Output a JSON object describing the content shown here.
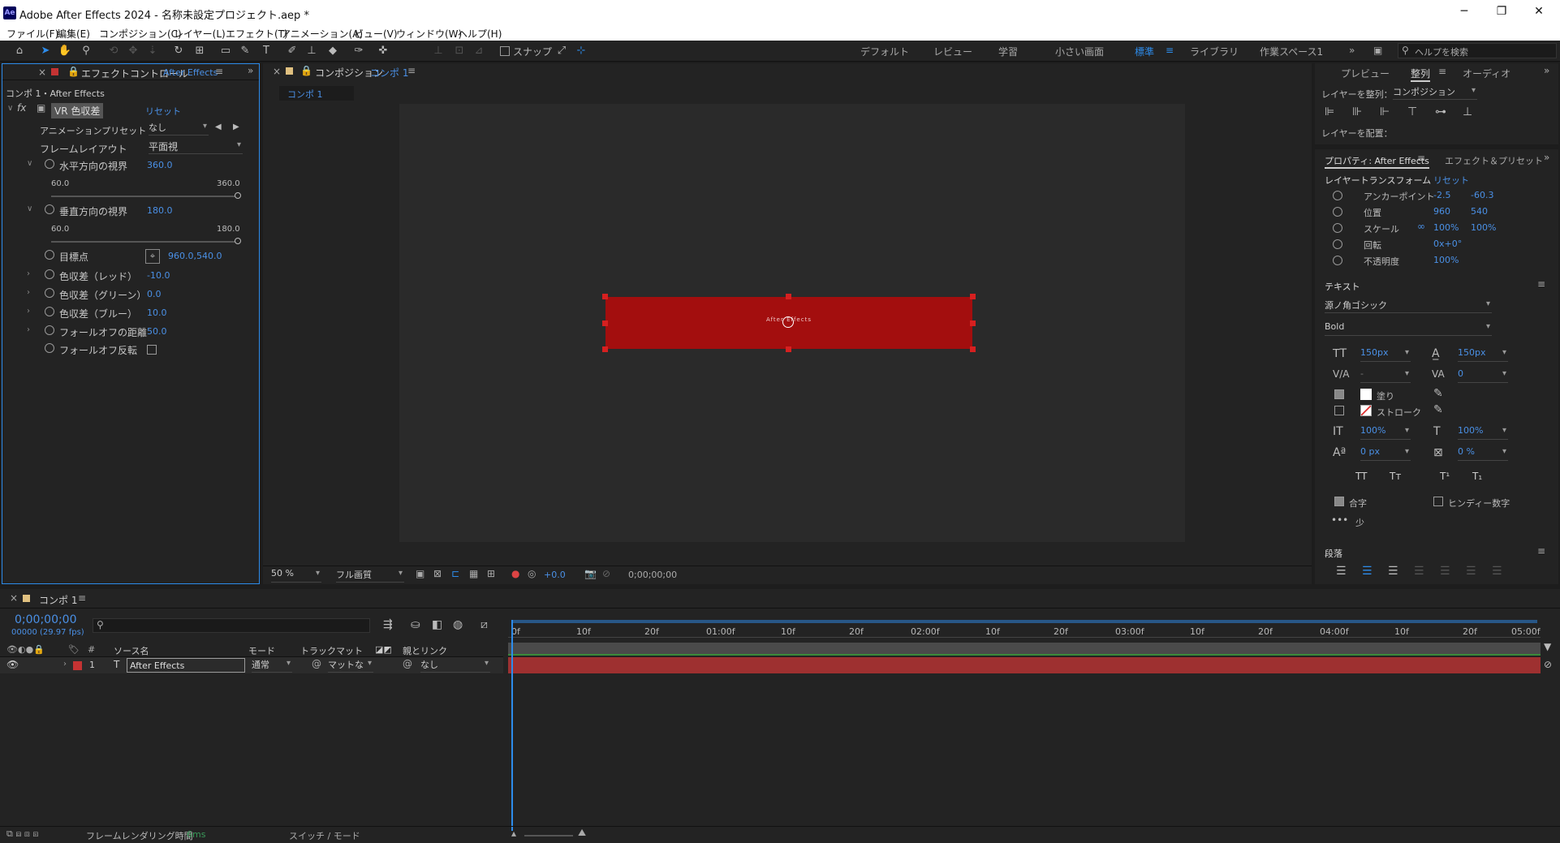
{
  "app": {
    "title": "Adobe After Effects 2024 - 名称未設定プロジェクト.aep *",
    "logo": "Ae"
  },
  "window": {
    "minimize": "─",
    "maximize": "❐",
    "close": "✕"
  },
  "menu": [
    "ファイル(F)",
    "編集(E)",
    "コンポジション(C)",
    "レイヤー(L)",
    "エフェクト(T)",
    "アニメーション(A)",
    "ビュー(V)",
    "ウィンドウ(W)",
    "ヘルプ(H)"
  ],
  "toolbar": {
    "snap": "スナップ",
    "workspaces": [
      "デフォルト",
      "レビュー",
      "学習",
      "小さい画面",
      "標準",
      "ライブラリ",
      "作業スペース1"
    ],
    "active_ws": "標準",
    "help_placeholder": "ヘルプを検索"
  },
  "effect_panel": {
    "tab": "エフェクトコントロール",
    "tab_target": "After Effects",
    "breadcrumb": "コンポ 1・After Effects",
    "effect": "VR 色収差",
    "reset": "リセット",
    "preset_label": "アニメーションプリセット",
    "preset_value": "なし",
    "layout_label": "フレームレイアウト",
    "layout_value": "平面視",
    "hfov_label": "水平方向の視界",
    "hfov_value": "360.0",
    "hfov_min": "60.0",
    "hfov_max": "360.0",
    "hfov_level": 1.0,
    "vfov_label": "垂直方向の視界",
    "vfov_value": "180.0",
    "vfov_min": "60.0",
    "vfov_max": "180.0",
    "vfov_level": 1.0,
    "target_label": "目標点",
    "target_value": "960.0,540.0",
    "red_label": "色収差（レッド）",
    "red_value": "-10.0",
    "green_label": "色収差（グリーン）",
    "green_value": "0.0",
    "blue_label": "色収差（ブルー）",
    "blue_value": "10.0",
    "falloff_label": "フォールオフの距離",
    "falloff_value": "50.0",
    "invert_label": "フォールオフ反転"
  },
  "comp_panel": {
    "tab": "コンポジション",
    "tab_target": "コンポ 1",
    "subtab": "コンポ 1",
    "zoom": "50 %",
    "quality": "フル画質",
    "exposure": "+0.0",
    "timecode": "0;00;00;00",
    "layer_text": "After Effects",
    "layer_color": "#a30e0e"
  },
  "right_panel": {
    "tabs": [
      "プレビュー",
      "整列",
      "オーディオ"
    ],
    "align_to_label": "レイヤーを整列：",
    "align_to_value": "コンポジション",
    "distribute_label": "レイヤーを配置：",
    "props_tab": "プロパティ: After Effects",
    "fx_tab": "エフェクト＆プリセット",
    "transform_label": "レイヤートランスフォーム",
    "reset": "リセット",
    "anchor_label": "アンカーポイント",
    "anchor_x": "-2.5",
    "anchor_y": "-60.3",
    "pos_label": "位置",
    "pos_x": "960",
    "pos_y": "540",
    "scale_label": "スケール",
    "scale_x": "100%",
    "scale_y": "100%",
    "rot_label": "回転",
    "rot_value": "0x+0°",
    "opacity_label": "不透明度",
    "opacity_value": "100%",
    "text_label": "テキスト",
    "font": "源ノ角ゴシック",
    "style": "Bold",
    "size": "150px",
    "leading": "150px",
    "kern": "-",
    "track": "0",
    "fill_label": "塗り",
    "stroke_label": "ストローク",
    "vscale": "100%",
    "hscale": "100%",
    "baseline": "0 px",
    "tsume": "0 %",
    "ligature": "合字",
    "hindi": "ヒンディー数字",
    "less": "少",
    "para_label": "段落"
  },
  "timeline": {
    "tab": "コンポ 1",
    "timecode": "0;00;00;00",
    "fps": "00000 (29.97 fps)",
    "col_source": "ソース名",
    "col_mode": "モード",
    "col_trkmat": "トラックマット",
    "col_parent": "親とリンク",
    "layer": {
      "index": "1",
      "name": "After Effects",
      "mode": "通常",
      "matte": "マットな",
      "parent": "なし"
    },
    "ruler": [
      "0f",
      "10f",
      "20f",
      "01:00f",
      "10f",
      "20f",
      "02:00f",
      "10f",
      "20f",
      "03:00f",
      "10f",
      "20f",
      "04:00f",
      "10f",
      "20f",
      "05:00f"
    ],
    "render_label": "フレームレンダリング時間",
    "render_value": "6ms",
    "switch_label": "スイッチ / モード"
  }
}
